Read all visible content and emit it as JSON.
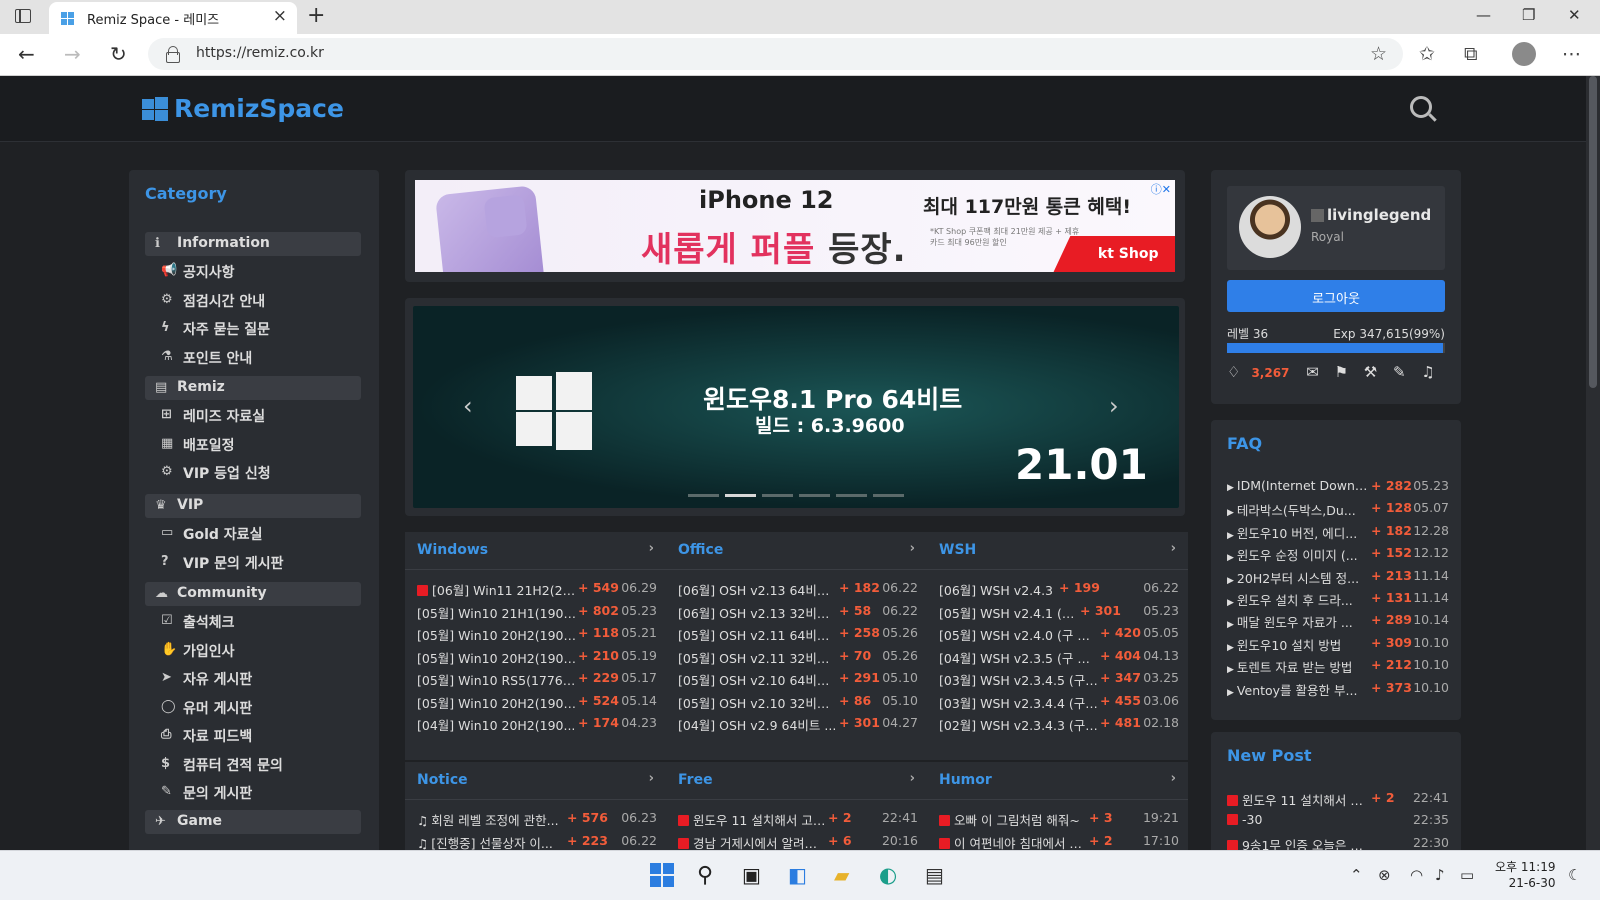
{
  "browser": {
    "tab_title": "Remiz Space - 레미즈",
    "url": "https://remiz.co.kr"
  },
  "site": {
    "logo": "RemizSpace"
  },
  "sidebar": {
    "title": "Category",
    "groups": [
      {
        "label": "Information",
        "icon": "info-icon",
        "items": [
          {
            "label": "공지사항",
            "icon": "megaphone-icon"
          },
          {
            "label": "점검시간 안내",
            "icon": "gears-icon"
          },
          {
            "label": "자주 묻는 질문",
            "icon": "bolt-icon"
          },
          {
            "label": "포인트 안내",
            "icon": "flask-icon"
          }
        ]
      },
      {
        "label": "Remiz",
        "icon": "document-icon",
        "items": [
          {
            "label": "레미즈 자료실",
            "icon": "windows-icon"
          },
          {
            "label": "배포일정",
            "icon": "calendar-icon"
          },
          {
            "label": "VIP 등업 신청",
            "icon": "gear-icon"
          }
        ]
      },
      {
        "label": "VIP",
        "icon": "trophy-icon",
        "items": [
          {
            "label": "Gold 자료실",
            "icon": "folder-icon"
          },
          {
            "label": "VIP 문의 게시판",
            "icon": "question-icon"
          }
        ]
      },
      {
        "label": "Community",
        "icon": "comments-icon",
        "items": [
          {
            "label": "출석체크",
            "icon": "check-icon"
          },
          {
            "label": "가입인사",
            "icon": "hand-icon"
          },
          {
            "label": "자유 게시판",
            "icon": "send-icon"
          },
          {
            "label": "유머 게시판",
            "icon": "chat-icon"
          },
          {
            "label": "자료 피드백",
            "icon": "inbox-icon"
          },
          {
            "label": "컴퓨터 견적 문의",
            "icon": "dollar-icon"
          },
          {
            "label": "문의 게시판",
            "icon": "edit-icon"
          }
        ]
      },
      {
        "label": "Game",
        "icon": "plane-icon",
        "items": []
      }
    ]
  },
  "ad": {
    "headline": "iPhone 12",
    "big_red": "새롭게 퍼플",
    "big_dark": " 등장.",
    "right": "최대 117만원 통큰 혜택!",
    "fine": "*KT Shop 쿠폰팩 최대 21만원 제공 + 제휴카드 최대 96만원 할인",
    "brand": "kt Shop"
  },
  "slider": {
    "title": "윈도우8.1 Pro 64비트",
    "subtitle": "빌드 : 6.3.9600",
    "version": "21.01",
    "active_dot": 1,
    "dot_count": 6
  },
  "boards": [
    {
      "name": "Windows",
      "rows": [
        {
          "t": "[06월] Win11 21H2(22...",
          "c": "+ 549",
          "d": "06.29",
          "hot": true
        },
        {
          "t": "[05월] Win10 21H1(1904...",
          "c": "+ 802",
          "d": "05.23"
        },
        {
          "t": "[05월] Win10 20H2(1904...",
          "c": "+ 118",
          "d": "05.21"
        },
        {
          "t": "[05월] Win10 20H2(1904...",
          "c": "+ 210",
          "d": "05.19"
        },
        {
          "t": "[05월] Win10 RS5(17763.1...",
          "c": "+ 229",
          "d": "05.17"
        },
        {
          "t": "[05월] Win10 20H2(1904...",
          "c": "+ 524",
          "d": "05.14"
        },
        {
          "t": "[04월] Win10 20H2(190...",
          "c": "+ 174",
          "d": "04.23"
        }
      ]
    },
    {
      "name": "Office",
      "rows": [
        {
          "t": "[06월] OSH v2.13 64비트...",
          "c": "+ 182",
          "d": "06.22"
        },
        {
          "t": "[06월] OSH v2.13 32비트 (...",
          "c": "+ 58",
          "d": "06.22"
        },
        {
          "t": "[05월] OSH v2.11 64비트 ...",
          "c": "+ 258",
          "d": "05.26"
        },
        {
          "t": "[05월] OSH v2.11 32비트 (...",
          "c": "+ 70",
          "d": "05.26"
        },
        {
          "t": "[05월] OSH v2.10 64비트 ...",
          "c": "+ 291",
          "d": "05.10"
        },
        {
          "t": "[05월] OSH v2.10 32비트 (...",
          "c": "+ 86",
          "d": "05.10"
        },
        {
          "t": "[04월] OSH v2.9 64비트 ...",
          "c": "+ 301",
          "d": "04.27"
        }
      ]
    },
    {
      "name": "WSH",
      "rows": [
        {
          "t": "[06월] WSH v2.4.3",
          "c": "+ 199",
          "d": "06.22"
        },
        {
          "t": "[05월] WSH v2.4.1 (구 필...",
          "c": "+ 301",
          "d": "05.23"
        },
        {
          "t": "[05월] WSH v2.4.0 (구 필...",
          "c": "+ 420",
          "d": "05.05"
        },
        {
          "t": "[04월] WSH v2.3.5 (구 필...",
          "c": "+ 404",
          "d": "04.13"
        },
        {
          "t": "[03월] WSH v2.3.4.5 (구 ...",
          "c": "+ 347",
          "d": "03.25"
        },
        {
          "t": "[03월] WSH v2.3.4.4 (구 ...",
          "c": "+ 455",
          "d": "03.06"
        },
        {
          "t": "[02월] WSH v2.3.4.3 (구 ...",
          "c": "+ 481",
          "d": "02.18"
        }
      ]
    },
    {
      "name": "Notice",
      "rows": [
        {
          "t": "회원 레벨 조정에 관한...",
          "c": "+ 576",
          "d": "06.23",
          "bell": true
        },
        {
          "t": "[진행중] 선물상자 이...",
          "c": "+ 223",
          "d": "06.22",
          "bell": true
        }
      ]
    },
    {
      "name": "Free",
      "rows": [
        {
          "t": "윈도우 11 설치해서 고급...",
          "c": "+ 2",
          "d": "22:41",
          "hot": true
        },
        {
          "t": "경남 거제시에서 알려드...",
          "c": "+ 6",
          "d": "20:16",
          "hot": true
        }
      ]
    },
    {
      "name": "Humor",
      "rows": [
        {
          "t": "오빠 이 그림처럼 해줘~",
          "c": "+ 3",
          "d": "19:21",
          "hot": true
        },
        {
          "t": "이 여편네야 침대에서 별...",
          "c": "+ 2",
          "d": "17:10",
          "hot": true
        }
      ]
    }
  ],
  "profile": {
    "name": "livinglegend",
    "rank": "Royal",
    "logout": "로그아웃",
    "level": "레벨 36",
    "exp": "Exp 347,615(99%)",
    "exp_pct": 99,
    "points": "3,267"
  },
  "faq": {
    "title": "FAQ",
    "rows": [
      {
        "t": "IDM(Internet Downl...",
        "c": "+ 282",
        "d": "05.23"
      },
      {
        "t": "테라박스(두박스,Du...",
        "c": "+ 128",
        "d": "05.07"
      },
      {
        "t": "윈도우10 버전, 에디...",
        "c": "+ 182",
        "d": "12.28"
      },
      {
        "t": "윈도우 순정 이미지 (...",
        "c": "+ 152",
        "d": "12.12"
      },
      {
        "t": "20H2부터 시스템 정...",
        "c": "+ 213",
        "d": "11.14"
      },
      {
        "t": "윈도우 설치 후 드라...",
        "c": "+ 131",
        "d": "11.14"
      },
      {
        "t": "매달 윈도우 자료가 ...",
        "c": "+ 289",
        "d": "10.14"
      },
      {
        "t": "윈도우10 설치 방법",
        "c": "+ 309",
        "d": "10.10"
      },
      {
        "t": "토렌트 자료 받는 방법",
        "c": "+ 212",
        "d": "10.10"
      },
      {
        "t": "Ventoy를 활용한 부...",
        "c": "+ 373",
        "d": "10.10"
      }
    ]
  },
  "newpost": {
    "title": "New Post",
    "rows": [
      {
        "t": "윈도우 11 설치해서 고...",
        "c": "+ 2",
        "d": "22:41"
      },
      {
        "t": "-30",
        "c": "",
        "d": "22:35"
      },
      {
        "t": "9송1무 인증 오늘은 내가...",
        "c": "",
        "d": "22:30"
      }
    ]
  },
  "clock": {
    "time": "오후 11:19",
    "date": "21-6-30"
  }
}
